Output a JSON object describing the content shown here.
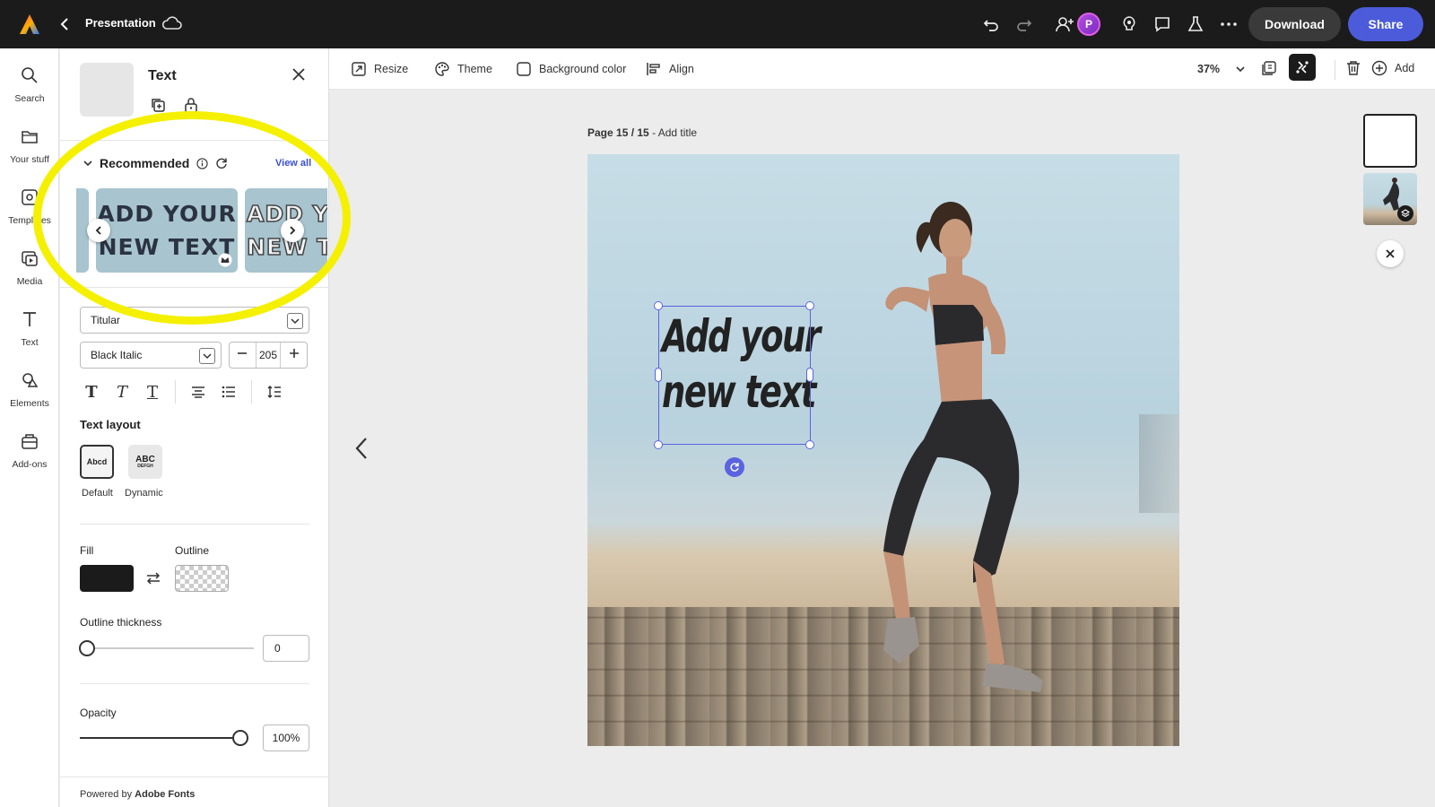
{
  "app": {
    "title": "Presentation",
    "download_label": "Download",
    "share_label": "Share",
    "brand_color": "#4b5bd9"
  },
  "rail": {
    "items": [
      {
        "label": "Search",
        "icon": "search-icon"
      },
      {
        "label": "Your stuff",
        "icon": "folder-icon"
      },
      {
        "label": "Templates",
        "icon": "templates-icon"
      },
      {
        "label": "Media",
        "icon": "media-icon"
      },
      {
        "label": "Text",
        "icon": "text-icon"
      },
      {
        "label": "Elements",
        "icon": "elements-icon"
      },
      {
        "label": "Add-ons",
        "icon": "addons-icon"
      }
    ]
  },
  "panel": {
    "title": "Text",
    "recommended_label": "Recommended",
    "view_all_label": "View all",
    "cards": [
      {
        "line1": "ADD YOUR",
        "line2": "NEW TEXT"
      },
      {
        "line1": "ADD Y",
        "line2": "NEW T"
      }
    ],
    "font_family": "Titular",
    "font_style": "Black Italic",
    "font_size": "205",
    "text_layout_label": "Text layout",
    "layouts": [
      {
        "label": "Default",
        "preview": "Abcd"
      },
      {
        "label": "Dynamic",
        "preview": "ABC"
      }
    ],
    "fill_label": "Fill",
    "outline_label": "Outline",
    "fill_color": "#1b1b1b",
    "outline_thickness_label": "Outline thickness",
    "outline_thickness_value": "0",
    "opacity_label": "Opacity",
    "opacity_value": "100%",
    "powered_prefix": "Powered by",
    "powered_brand": "Adobe Fonts"
  },
  "toolbar": {
    "resize_label": "Resize",
    "theme_label": "Theme",
    "background_label": "Background color",
    "align_label": "Align",
    "zoom_label": "37%",
    "add_label": "Add"
  },
  "canvas": {
    "page_label": "Page 15 / 15",
    "page_title": "Add title",
    "text_line1": "Add your",
    "text_line2": "new text",
    "selection_color": "#5a63e0",
    "highlight_color": "#f4f000"
  }
}
